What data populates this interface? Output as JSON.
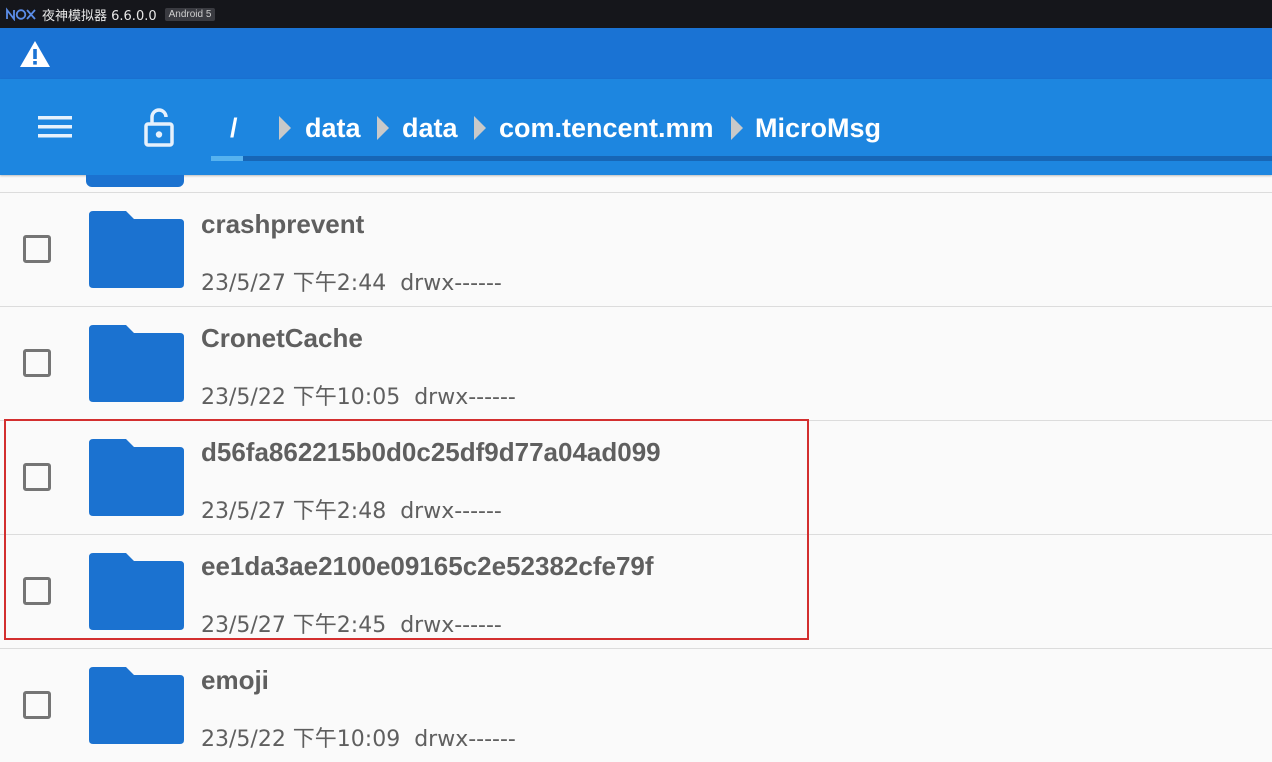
{
  "window": {
    "app_title": "夜神模拟器 6.6.0.0",
    "android_badge": "Android 5"
  },
  "status_bar": {
    "warning_icon": "warning-icon"
  },
  "toolbar": {
    "menu_icon": "menu-icon",
    "lock_icon": "unlock-icon",
    "root_label": "/",
    "breadcrumbs": [
      "data",
      "data",
      "com.tencent.mm",
      "MicroMsg"
    ],
    "colors": {
      "toolbar": "#1d86e0",
      "status": "#1a73d4"
    }
  },
  "file_list": {
    "items": [
      {
        "name": "crashprevent",
        "date": "23/5/27 下午2:44",
        "perm": "drwx------"
      },
      {
        "name": "CronetCache",
        "date": "23/5/22 下午10:05",
        "perm": "drwx------"
      },
      {
        "name": "d56fa862215b0d0c25df9d77a04ad099",
        "date": "23/5/27 下午2:48",
        "perm": "drwx------"
      },
      {
        "name": "ee1da3ae2100e09165c2e52382cfe79f",
        "date": "23/5/27 下午2:45",
        "perm": "drwx------"
      },
      {
        "name": "emoji",
        "date": "23/5/22 下午10:09",
        "perm": "drwx------"
      }
    ],
    "folder_color": "#1b72d0",
    "highlight_color": "#d32f2f"
  }
}
